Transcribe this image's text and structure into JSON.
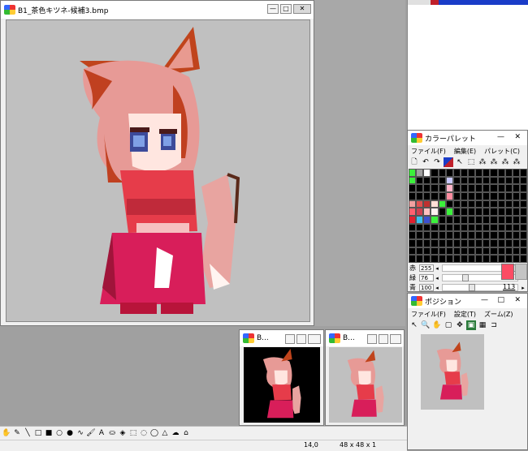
{
  "colors": {
    "accent": "#1a4cc8",
    "swatch": "#fc4c64",
    "secondary_swatch": "#c4c4c4",
    "canvas_bg": "#c0c0c0",
    "thumb_dark_bg": "#000000"
  },
  "main_window": {
    "title": "B1_茶色キツネ-候補3.bmp",
    "minimize": "—",
    "maximize": "□",
    "close": "✕"
  },
  "thumb_window_1": {
    "title": "B..."
  },
  "thumb_window_2": {
    "title": "B..."
  },
  "palette_window": {
    "title": "カラーパレット",
    "menus": [
      "ファイル(F)",
      "編集(E)",
      "パレット(C)"
    ],
    "minimize": "—",
    "close": "✕",
    "sliders": [
      {
        "label": "赤",
        "value": "255",
        "fraction": 0.98
      },
      {
        "label": "緑",
        "value": "76",
        "fraction": 0.3
      },
      {
        "label": "青",
        "value": "100",
        "fraction": 0.39
      }
    ],
    "index_value": "113"
  },
  "position_window": {
    "title": "ポジション",
    "menus": [
      "ファイル(F)",
      "設定(T)",
      "ズーム(Z)"
    ],
    "minimize": "—",
    "maximize": "□",
    "close": "✕"
  },
  "status_bar": {
    "coords": "14,0",
    "image_size": "48 x 48 x 1"
  },
  "toolbar_icons": [
    "hand-icon",
    "pencil-icon",
    "line-icon",
    "rectangle-icon",
    "filled-rectangle-icon",
    "ellipse-icon",
    "filled-ellipse-icon",
    "curve-icon",
    "brush-icon",
    "text-icon",
    "bucket-icon",
    "fill-icon",
    "select-rect-icon",
    "select-ellipse-icon",
    "lasso-icon",
    "polygon-icon",
    "cloud-icon",
    "stamp-icon"
  ]
}
